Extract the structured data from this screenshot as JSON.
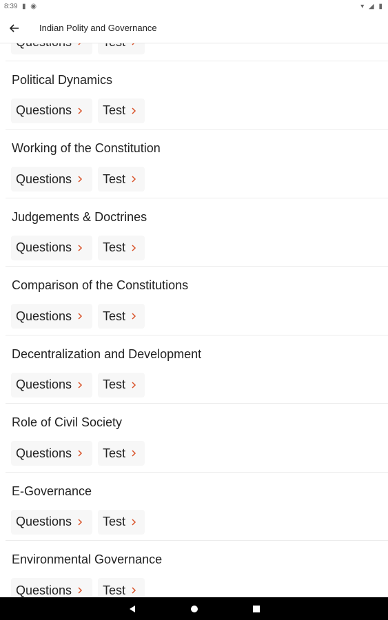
{
  "status_bar": {
    "time": "8:39",
    "left_icons": [
      "sim-card-icon",
      "vpn-icon"
    ],
    "right_icons": [
      "wifi-icon",
      "signal-icon",
      "battery-icon"
    ]
  },
  "app_bar": {
    "title": "Indian Polity and Governance",
    "back_icon": "arrow-back-icon"
  },
  "colors": {
    "accent_arrow": "#d9532a",
    "chip_background": "#f7f7f7",
    "divider": "#ececec"
  },
  "chip_labels": {
    "questions": "Questions",
    "test": "Test"
  },
  "topics": [
    {
      "title": ""
    },
    {
      "title": "Political Dynamics"
    },
    {
      "title": "Working of the Constitution"
    },
    {
      "title": "Judgements & Doctrines"
    },
    {
      "title": "Comparison of the Constitutions"
    },
    {
      "title": "Decentralization and Development"
    },
    {
      "title": "Role of Civil Society"
    },
    {
      "title": "E-Governance"
    },
    {
      "title": "Environmental Governance"
    }
  ],
  "nav_bar": {
    "icons": [
      "back-triangle-icon",
      "home-circle-icon",
      "recents-square-icon"
    ]
  }
}
